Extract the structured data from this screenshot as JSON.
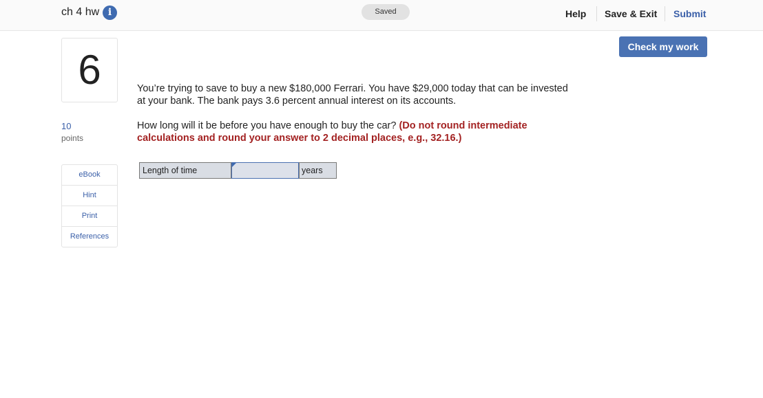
{
  "header": {
    "assignment_title": "ch 4 hw",
    "status": "Saved",
    "help_label": "Help",
    "save_exit_label": "Save & Exit",
    "submit_label": "Submit"
  },
  "toolbar": {
    "check_label": "Check my work"
  },
  "question": {
    "number": "6",
    "points_value": "10",
    "points_label": "points",
    "paragraph1": "You’re trying to save to buy a new $180,000 Ferrari. You have $29,000 today that can be invested at your bank. The bank pays 3.6 percent annual interest on its accounts.",
    "paragraph2_text": "How long will it be before you have enough to buy the car? ",
    "paragraph2_emphasis": "(Do not round intermediate calculations and round your answer to 2 decimal places, e.g., 32.16.)"
  },
  "answer": {
    "label": "Length of time",
    "value": "",
    "unit": "years"
  },
  "resources": [
    "eBook",
    "Hint",
    "Print",
    "References"
  ],
  "colors": {
    "accent": "#4a72b3",
    "link": "#3a5fa8",
    "emphasis": "#a32222",
    "info_icon": "#3f6bb0"
  },
  "icons": {
    "info": "info-icon"
  }
}
